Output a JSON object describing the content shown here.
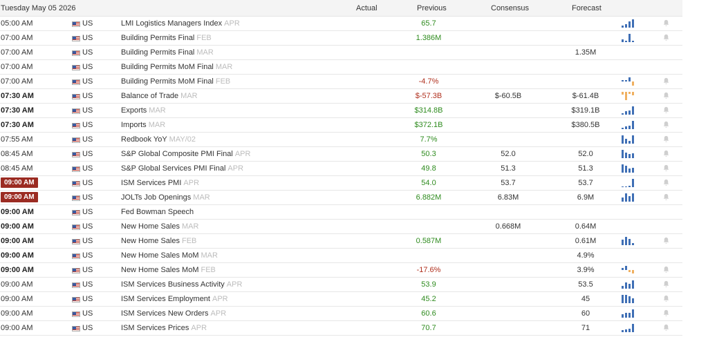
{
  "header": {
    "date": "Tuesday May 05 2026",
    "col_actual": "Actual",
    "col_previous": "Previous",
    "col_consensus": "Consensus",
    "col_forecast": "Forecast"
  },
  "colors": {
    "positive": "#2e8b1e",
    "negative": "#b0301e",
    "live_badge": "#9b2b22",
    "spark_blue": "#3f6fb5",
    "spark_orange": "#f0b060"
  },
  "rows": [
    {
      "time": "05:00 AM",
      "style": "normal",
      "country": "US",
      "event": "LMI Logistics Managers Index",
      "ref": "APR",
      "previous": "65.7",
      "prev_sign": "pos",
      "consensus": "",
      "forecast": "",
      "spark": [
        3,
        5,
        8,
        11
      ],
      "spark_color": "blue",
      "bell": true
    },
    {
      "time": "07:00 AM",
      "style": "normal",
      "country": "US",
      "event": "Building Permits Final",
      "ref": "FEB",
      "previous": "1.386M",
      "prev_sign": "pos",
      "consensus": "",
      "forecast": "",
      "spark": [
        4,
        2,
        11,
        2
      ],
      "spark_color": "blue",
      "bell": true
    },
    {
      "time": "07:00 AM",
      "style": "normal",
      "country": "US",
      "event": "Building Permits Final",
      "ref": "MAR",
      "previous": "",
      "prev_sign": "",
      "consensus": "",
      "forecast": "1.35M",
      "spark": [],
      "spark_color": "",
      "bell": false
    },
    {
      "time": "07:00 AM",
      "style": "normal",
      "country": "US",
      "event": "Building Permits MoM Final",
      "ref": "MAR",
      "previous": "",
      "prev_sign": "",
      "consensus": "",
      "forecast": "",
      "spark": [],
      "spark_color": "",
      "bell": false
    },
    {
      "time": "07:00 AM",
      "style": "normal",
      "country": "US",
      "event": "Building Permits MoM Final",
      "ref": "FEB",
      "previous": "-4.7%",
      "prev_sign": "neg",
      "consensus": "",
      "forecast": "",
      "spark": [
        1,
        1,
        3,
        -3
      ],
      "spark_color": "mixed",
      "bell": true
    },
    {
      "time": "07:30 AM",
      "style": "bold",
      "country": "US",
      "event": "Balance of Trade",
      "ref": "MAR",
      "previous": "$-57.3B",
      "prev_sign": "neg",
      "consensus": "$-60.5B",
      "forecast": "$-61.4B",
      "spark": [
        -3,
        -9,
        -2,
        -4
      ],
      "spark_color": "orange",
      "bell": true
    },
    {
      "time": "07:30 AM",
      "style": "bold",
      "country": "US",
      "event": "Exports",
      "ref": "MAR",
      "previous": "$314.8B",
      "prev_sign": "pos",
      "consensus": "",
      "forecast": "$319.1B",
      "spark": [
        2,
        4,
        5,
        10
      ],
      "spark_color": "blue",
      "bell": true
    },
    {
      "time": "07:30 AM",
      "style": "bold",
      "country": "US",
      "event": "Imports",
      "ref": "MAR",
      "previous": "$372.1B",
      "prev_sign": "pos",
      "consensus": "",
      "forecast": "$380.5B",
      "spark": [
        2,
        3,
        4,
        10
      ],
      "spark_color": "blue",
      "bell": true
    },
    {
      "time": "07:55 AM",
      "style": "normal",
      "country": "US",
      "event": "Redbook YoY",
      "ref": "MAY/02",
      "previous": "7.7%",
      "prev_sign": "pos",
      "consensus": "",
      "forecast": "",
      "spark": [
        10,
        6,
        3,
        10
      ],
      "spark_color": "blue",
      "bell": true
    },
    {
      "time": "08:45 AM",
      "style": "normal",
      "country": "US",
      "event": "S&P Global Composite PMI Final",
      "ref": "APR",
      "previous": "50.3",
      "prev_sign": "pos",
      "consensus": "52.0",
      "forecast": "52.0",
      "spark": [
        10,
        7,
        5,
        6
      ],
      "spark_color": "blue",
      "bell": true
    },
    {
      "time": "08:45 AM",
      "style": "normal",
      "country": "US",
      "event": "S&P Global Services PMI Final",
      "ref": "APR",
      "previous": "49.8",
      "prev_sign": "pos",
      "consensus": "51.3",
      "forecast": "51.3",
      "spark": [
        10,
        8,
        5,
        6
      ],
      "spark_color": "blue",
      "bell": true
    },
    {
      "time": "09:00 AM",
      "style": "red",
      "country": "US",
      "event": "ISM Services PMI",
      "ref": "APR",
      "previous": "54.0",
      "prev_sign": "pos",
      "consensus": "53.7",
      "forecast": "53.7",
      "spark": [
        1,
        1,
        2,
        11
      ],
      "spark_color": "blue",
      "bell": true
    },
    {
      "time": "09:00 AM",
      "style": "red",
      "country": "US",
      "event": "JOLTs Job Openings",
      "ref": "MAR",
      "previous": "6.882M",
      "prev_sign": "pos",
      "consensus": "6.83M",
      "forecast": "6.9M",
      "spark": [
        3,
        6,
        4,
        6
      ],
      "spark_color": "blue",
      "bell": true
    },
    {
      "time": "09:00 AM",
      "style": "bold",
      "country": "US",
      "event": "Fed Bowman Speech",
      "ref": "",
      "previous": "",
      "prev_sign": "",
      "consensus": "",
      "forecast": "",
      "spark": [],
      "spark_color": "",
      "bell": false
    },
    {
      "time": "09:00 AM",
      "style": "bold",
      "country": "US",
      "event": "New Home Sales",
      "ref": "MAR",
      "previous": "",
      "prev_sign": "",
      "consensus": "0.668M",
      "forecast": "0.64M",
      "spark": [],
      "spark_color": "",
      "bell": false
    },
    {
      "time": "09:00 AM",
      "style": "bold",
      "country": "US",
      "event": "New Home Sales",
      "ref": "FEB",
      "previous": "0.587M",
      "prev_sign": "pos",
      "consensus": "",
      "forecast": "0.61M",
      "spark": [
        5,
        8,
        6,
        2
      ],
      "spark_color": "blue",
      "bell": true
    },
    {
      "time": "09:00 AM",
      "style": "bold",
      "country": "US",
      "event": "New Home Sales MoM",
      "ref": "MAR",
      "previous": "",
      "prev_sign": "",
      "consensus": "",
      "forecast": "4.9%",
      "spark": [],
      "spark_color": "",
      "bell": false
    },
    {
      "time": "09:00 AM",
      "style": "bold",
      "country": "US",
      "event": "New Home Sales MoM",
      "ref": "FEB",
      "previous": "-17.6%",
      "prev_sign": "neg",
      "consensus": "",
      "forecast": "3.9%",
      "spark": [
        2,
        4,
        -2,
        -3
      ],
      "spark_color": "mixed",
      "bell": true
    },
    {
      "time": "09:00 AM",
      "style": "normal",
      "country": "US",
      "event": "ISM Services Business Activity",
      "ref": "APR",
      "previous": "53.9",
      "prev_sign": "pos",
      "consensus": "",
      "forecast": "53.5",
      "spark": [
        4,
        8,
        6,
        11
      ],
      "spark_color": "blue",
      "bell": true
    },
    {
      "time": "09:00 AM",
      "style": "normal",
      "country": "US",
      "event": "ISM Services Employment",
      "ref": "APR",
      "previous": "45.2",
      "prev_sign": "pos",
      "consensus": "",
      "forecast": "45",
      "spark": [
        10,
        10,
        8,
        6
      ],
      "spark_color": "blue",
      "bell": true
    },
    {
      "time": "09:00 AM",
      "style": "normal",
      "country": "US",
      "event": "ISM Services New Orders",
      "ref": "APR",
      "previous": "60.6",
      "prev_sign": "pos",
      "consensus": "",
      "forecast": "60",
      "spark": [
        4,
        6,
        6,
        10
      ],
      "spark_color": "blue",
      "bell": true
    },
    {
      "time": "09:00 AM",
      "style": "normal",
      "country": "US",
      "event": "ISM Services Prices",
      "ref": "APR",
      "previous": "70.7",
      "prev_sign": "pos",
      "consensus": "",
      "forecast": "71",
      "spark": [
        3,
        4,
        5,
        11
      ],
      "spark_color": "blue",
      "bell": true
    }
  ]
}
